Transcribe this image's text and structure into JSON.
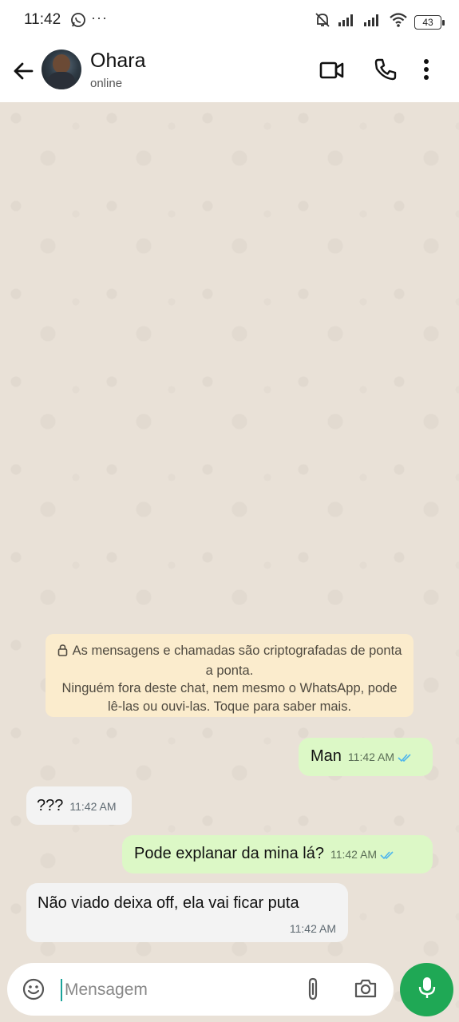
{
  "status_bar": {
    "time": "11:42",
    "more": "···",
    "battery": "43"
  },
  "header": {
    "contact_name": "Ohara",
    "contact_status": "online"
  },
  "encryption_notice": {
    "line1": "As mensagens e chamadas são criptografadas de ponta a ponta.",
    "line2": "Ninguém fora deste chat, nem mesmo o WhatsApp, pode lê-las ou ouvi-las. Toque para saber mais."
  },
  "messages": [
    {
      "direction": "outgoing",
      "text": "Man",
      "time": "11:42 AM",
      "read": true
    },
    {
      "direction": "incoming",
      "text": "???",
      "time": "11:42 AM"
    },
    {
      "direction": "outgoing",
      "text": "Pode explanar da mina lá?",
      "time": "11:42 AM",
      "read": true
    },
    {
      "direction": "incoming",
      "text": "Não viado deixa off, ela vai ficar puta",
      "time": "11:42 AM"
    }
  ],
  "composer": {
    "placeholder": "Mensagem"
  },
  "colors": {
    "accent_green": "#1fa855",
    "outgoing_bubble": "#dcf8c6",
    "read_ticks": "#4fb6ec",
    "notice_bg": "#fbeccd"
  },
  "icons": [
    "whatsapp-icon",
    "mute-icon",
    "signal-icon",
    "wifi-icon",
    "battery-icon",
    "back-arrow-icon",
    "video-call-icon",
    "phone-icon",
    "more-vert-icon",
    "lock-icon",
    "double-check-icon",
    "emoji-icon",
    "attach-icon",
    "camera-icon",
    "mic-icon"
  ]
}
